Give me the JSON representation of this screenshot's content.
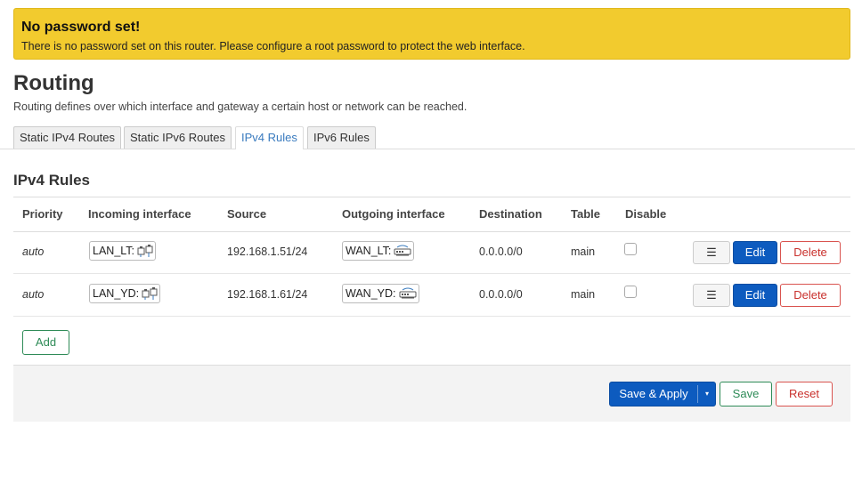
{
  "alert": {
    "title": "No password set!",
    "text": "There is no password set on this router. Please configure a root password to protect the web interface."
  },
  "page": {
    "title": "Routing",
    "description": "Routing defines over which interface and gateway a certain host or network can be reached."
  },
  "tabs": [
    {
      "label": "Static IPv4 Routes",
      "active": false
    },
    {
      "label": "Static IPv6 Routes",
      "active": false
    },
    {
      "label": "IPv4 Rules",
      "active": true
    },
    {
      "label": "IPv6 Rules",
      "active": false
    }
  ],
  "section": {
    "title": "IPv4 Rules"
  },
  "table": {
    "headers": [
      "Priority",
      "Incoming interface",
      "Source",
      "Outgoing interface",
      "Destination",
      "Table",
      "Disable"
    ],
    "rows": [
      {
        "priority": "auto",
        "incoming": "LAN_LT:",
        "incoming_icon": "network-ports-icon",
        "source": "192.168.1.51/24",
        "outgoing": "WAN_LT:",
        "outgoing_icon": "wireless-device-icon",
        "destination": "0.0.0.0/0",
        "table": "main",
        "disabled": false
      },
      {
        "priority": "auto",
        "incoming": "LAN_YD:",
        "incoming_icon": "network-ports-icon",
        "source": "192.168.1.61/24",
        "outgoing": "WAN_YD:",
        "outgoing_icon": "wireless-device-icon",
        "destination": "0.0.0.0/0",
        "table": "main",
        "disabled": false
      }
    ]
  },
  "row_actions": {
    "menu": "☰",
    "edit": "Edit",
    "delete": "Delete"
  },
  "buttons": {
    "add": "Add",
    "save_apply": "Save & Apply",
    "caret": "▾",
    "save": "Save",
    "reset": "Reset"
  },
  "colors": {
    "alert": "#f2cb2e",
    "primary": "#0d5bbf",
    "positive": "#2e8b57",
    "negative": "#c9302c"
  }
}
